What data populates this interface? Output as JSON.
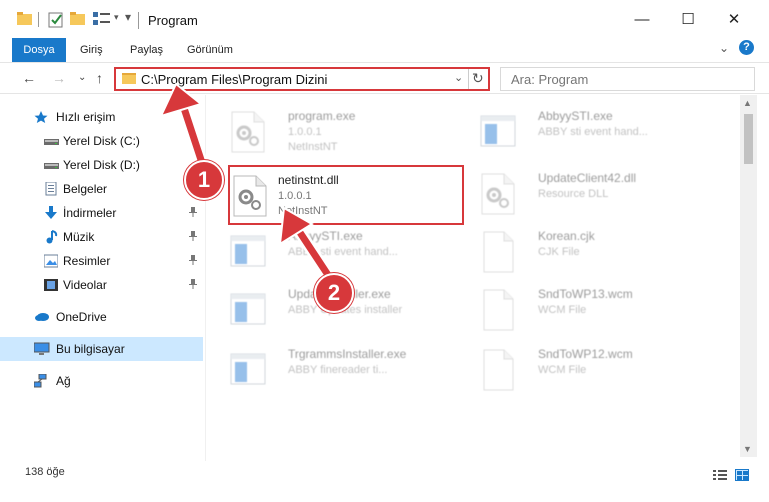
{
  "window": {
    "title": "Program",
    "buttons": {
      "minimize": "—",
      "maximize": "☐",
      "close": "✕"
    }
  },
  "ribbon": {
    "tabs": [
      "Dosya",
      "Giriş",
      "Paylaş",
      "Görünüm"
    ],
    "expand": "⌄",
    "help": "?"
  },
  "address": {
    "path": "C:\\Program Files\\Program Dizini",
    "chevron": "⌄",
    "refresh": "↻",
    "search_placeholder": "Ara: Program",
    "nav": {
      "back": "←",
      "forward": "→",
      "recent": "⌄",
      "up": "↑"
    }
  },
  "sidebar": {
    "items": [
      {
        "label": "Hızlı erişim",
        "icon": "star-icon",
        "pinned": false,
        "selected": false
      },
      {
        "label": "Yerel Disk (C:)",
        "icon": "drive-icon",
        "pinned": false,
        "selected": false
      },
      {
        "label": "Yerel Disk (D:)",
        "icon": "drive-icon",
        "pinned": false,
        "selected": false
      },
      {
        "label": "Belgeler",
        "icon": "documents-icon",
        "pinned": false,
        "selected": false
      },
      {
        "label": "İndirmeler",
        "icon": "download-icon",
        "pinned": true,
        "selected": false
      },
      {
        "label": "Müzik",
        "icon": "music-icon",
        "pinned": true,
        "selected": false
      },
      {
        "label": "Resimler",
        "icon": "pictures-icon",
        "pinned": true,
        "selected": false
      },
      {
        "label": "Videolar",
        "icon": "videos-icon",
        "pinned": true,
        "selected": false
      },
      {
        "label": "OneDrive",
        "icon": "cloud-icon",
        "pinned": false,
        "selected": false
      },
      {
        "label": "Bu bilgisayar",
        "icon": "computer-icon",
        "pinned": false,
        "selected": true
      },
      {
        "label": "Ağ",
        "icon": "network-icon",
        "pinned": false,
        "selected": false
      }
    ],
    "pin_glyph": "📌"
  },
  "files": {
    "left": [
      {
        "name": "program.exe",
        "line2": "1.0.0.1",
        "line3": "NetInstNT",
        "icon": "gear-app-icon",
        "faded": true
      },
      {
        "name": "netinstnt.dll",
        "line2": "1.0.0.1",
        "line3": "NetInstNT",
        "icon": "dll-gear-icon",
        "faded": false,
        "highlight": true
      },
      {
        "name": "AbbyySTI.exe",
        "line2": "ABBY sti event hand...",
        "line3": "",
        "icon": "app-window-icon",
        "faded": true
      },
      {
        "name": "UpdateInstaller.exe",
        "line2": "ABBY Updates installer",
        "line3": "",
        "icon": "app-window-icon",
        "faded": true
      },
      {
        "name": "TrgrammsInstaller.exe",
        "line2": "ABBY finereader ti...",
        "line3": "",
        "icon": "app-window-icon",
        "faded": true
      }
    ],
    "right": [
      {
        "name": "AbbyySTI.exe",
        "line2": "ABBY sti event hand...",
        "line3": "",
        "icon": "app-window-icon"
      },
      {
        "name": "UpdateClient42.dll",
        "line2": "Resource DLL",
        "line3": "",
        "icon": "dll-gear-icon"
      },
      {
        "name": "Korean.cjk",
        "line2": "CJK File",
        "line3": "",
        "icon": "document-icon"
      },
      {
        "name": "SndToWP13.wcm",
        "line2": "WCM File",
        "line3": "",
        "icon": "document-icon"
      },
      {
        "name": "SndToWP12.wcm",
        "line2": "WCM File",
        "line3": "",
        "icon": "document-icon"
      }
    ]
  },
  "status": {
    "count": "138 öğe"
  },
  "annotations": {
    "step1": "1",
    "step2": "2"
  },
  "colors": {
    "accent": "#1979ca",
    "highlight": "#d7383b",
    "selected": "#cce8ff"
  }
}
